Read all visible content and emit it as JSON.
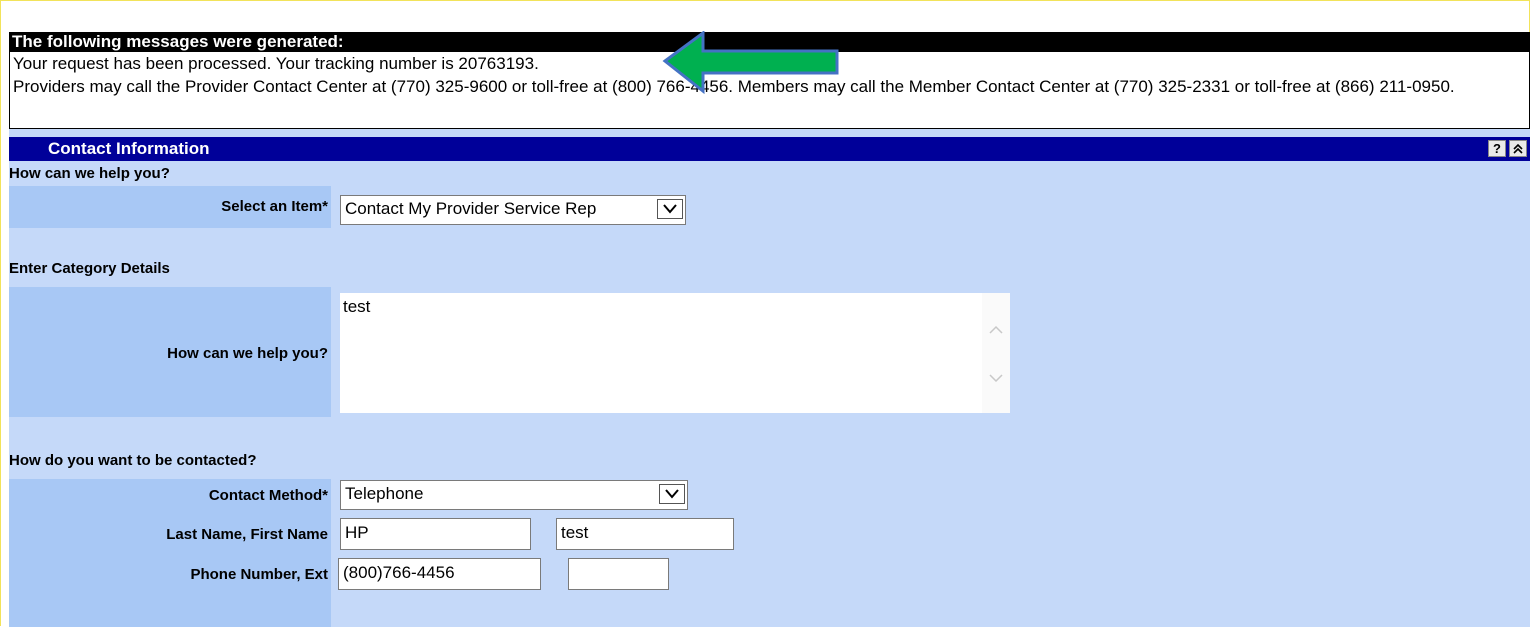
{
  "messages": {
    "header": "The following messages were generated:",
    "line1": "Your request has been processed. Your tracking number is 20763193.",
    "line2": "Providers may call the Provider Contact Center at (770) 325-9600 or toll-free at (800) 766-4456. Members may call the Member Contact Center at (770) 325-2331 or toll-free at (866) 211-0950."
  },
  "annotation": {
    "arrow_color": "#00b050"
  },
  "section": {
    "title": "Contact Information",
    "help_icon": "?",
    "collapse_icon": "double-chevron-up"
  },
  "help": {
    "subhead": "How can we help you?",
    "select_label": "Select an Item*",
    "select_value": "Contact My Provider Service Rep"
  },
  "category": {
    "subhead": "Enter Category Details",
    "text_label": "How can we help you?",
    "text_value": "test"
  },
  "contact": {
    "subhead": "How do you want to be contacted?",
    "method_label": "Contact Method*",
    "method_value": "Telephone",
    "name_label": "Last Name, First Name",
    "last_name": "HP",
    "first_name": "test",
    "phone_label": "Phone Number, Ext",
    "phone": "(800)766-4456",
    "ext": ""
  },
  "colors": {
    "header_bg": "#000099",
    "section_bg": "#c5d9f9",
    "label_bg": "#a8c8f5"
  }
}
